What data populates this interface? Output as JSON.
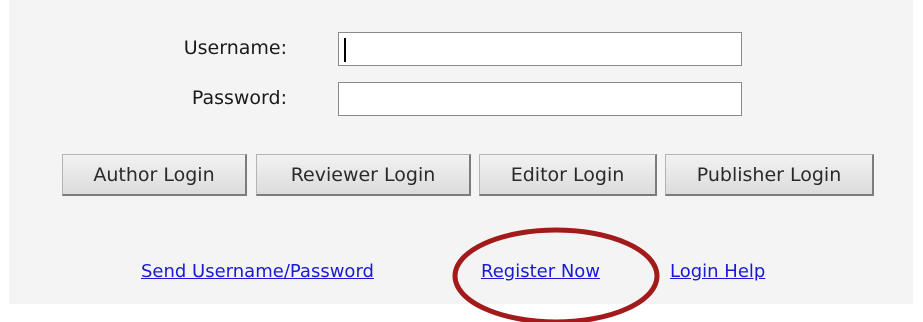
{
  "form": {
    "username_label": "Username:",
    "password_label": "Password:",
    "username_value": "",
    "password_value": ""
  },
  "buttons": {
    "author_login": "Author Login",
    "reviewer_login": "Reviewer Login",
    "editor_login": "Editor Login",
    "publisher_login": "Publisher Login"
  },
  "links": {
    "send_credentials": "Send Username/Password",
    "register_now": "Register Now",
    "login_help": "Login Help"
  },
  "colors": {
    "link": "#1a1ad6",
    "highlight_circle": "#a31a1a",
    "panel_background": "#f4f4f4"
  }
}
